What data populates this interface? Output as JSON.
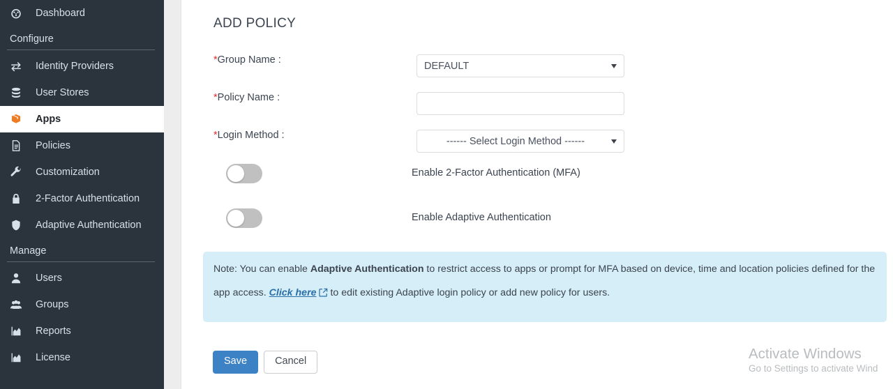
{
  "sidebar": {
    "items": [
      {
        "type": "item",
        "label": "Dashboard",
        "icon": "dashboard-gauge-icon",
        "name": "dashboard",
        "active": false
      },
      {
        "type": "section",
        "label": "Configure",
        "name": "configure"
      },
      {
        "type": "item",
        "label": "Identity Providers",
        "icon": "exchange-arrows-icon",
        "name": "identity-providers",
        "active": false
      },
      {
        "type": "item",
        "label": "User Stores",
        "icon": "database-icon",
        "name": "user-stores",
        "active": false
      },
      {
        "type": "item",
        "label": "Apps",
        "icon": "box-icon",
        "name": "apps",
        "active": true
      },
      {
        "type": "item",
        "label": "Policies",
        "icon": "document-icon",
        "name": "policies",
        "active": false
      },
      {
        "type": "item",
        "label": "Customization",
        "icon": "wrench-icon",
        "name": "customization",
        "active": false
      },
      {
        "type": "item",
        "label": "2-Factor Authentication",
        "icon": "lock-icon",
        "name": "two-factor-authentication",
        "active": false
      },
      {
        "type": "item",
        "label": "Adaptive Authentication",
        "icon": "shield-icon",
        "name": "adaptive-authentication",
        "active": false
      },
      {
        "type": "section",
        "label": "Manage",
        "name": "manage"
      },
      {
        "type": "item",
        "label": "Users",
        "icon": "user-icon",
        "name": "users",
        "active": false
      },
      {
        "type": "item",
        "label": "Groups",
        "icon": "users-group-icon",
        "name": "groups",
        "active": false
      },
      {
        "type": "item",
        "label": "Reports",
        "icon": "chart-area-icon",
        "name": "reports",
        "active": false
      },
      {
        "type": "item",
        "label": "License",
        "icon": "chart-area-icon",
        "name": "license",
        "active": false
      }
    ],
    "colors": {
      "background": "#2b333d",
      "text": "#d6e0e8",
      "active_background": "#ffffff",
      "active_text": "#22272c",
      "apps_icon": "#f07c22"
    }
  },
  "main": {
    "title": "ADD POLICY",
    "fields": {
      "group_name": {
        "label": "Group Name :",
        "required_marker": "*",
        "value": "DEFAULT",
        "control": "select"
      },
      "policy_name": {
        "label": "Policy Name :",
        "required_marker": "*",
        "value": "",
        "placeholder": "",
        "control": "text"
      },
      "login_method": {
        "label": "Login Method :",
        "required_marker": "*",
        "value": "------ Select Login Method ------",
        "control": "select"
      }
    },
    "toggles": [
      {
        "label": "Enable 2-Factor Authentication (MFA)",
        "state": "off",
        "name": "mfa"
      },
      {
        "label": "Enable Adaptive Authentication",
        "state": "off",
        "name": "adaptive"
      }
    ],
    "note": {
      "line1_a": "Note: You can enable ",
      "line1_bold": "Adaptive Authentication",
      "line1_b": " to restrict access to apps or prompt for MFA based on device, time and location policies defined for the",
      "line2_a": "app access. ",
      "line2_link": "Click here",
      "line2_b": "to edit existing Adaptive login policy or add new policy for users.",
      "background": "#d6eef7",
      "link_color": "#2a6fa8"
    },
    "buttons": {
      "save": "Save",
      "cancel": "Cancel",
      "save_color": "#3c82c4"
    }
  },
  "watermark": {
    "line1": "Activate Windows",
    "line2": "Go to Settings to activate Wind"
  }
}
